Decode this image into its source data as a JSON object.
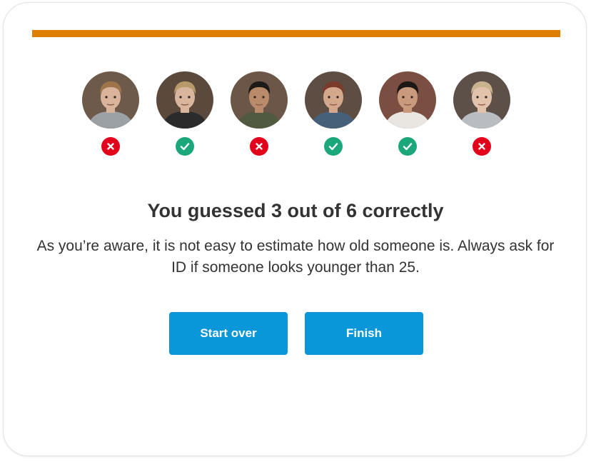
{
  "progress": {
    "fraction": 1.0,
    "color": "#e07e00"
  },
  "faces": [
    {
      "result": "incorrect",
      "icon": "cross-icon",
      "skin": "#d9b49a",
      "hair": "#a0744a",
      "shirt": "#9aa0a4",
      "bg": "#6e5a4b"
    },
    {
      "result": "correct",
      "icon": "check-icon",
      "skin": "#d8b59c",
      "hair": "#b89a6a",
      "shirt": "#2b2b2b",
      "bg": "#5b4a3c"
    },
    {
      "result": "incorrect",
      "icon": "cross-icon",
      "skin": "#b98b6b",
      "hair": "#1e1a18",
      "shirt": "#4f5a40",
      "bg": "#6b5648"
    },
    {
      "result": "correct",
      "icon": "check-icon",
      "skin": "#d4a88c",
      "hair": "#7a3b2c",
      "shirt": "#46607a",
      "bg": "#5d4d42"
    },
    {
      "result": "correct",
      "icon": "check-icon",
      "skin": "#c99a7c",
      "hair": "#1b1816",
      "shirt": "#e9e6e1",
      "bg": "#7a4e40"
    },
    {
      "result": "incorrect",
      "icon": "cross-icon",
      "skin": "#e2c2ab",
      "hair": "#c9b38e",
      "shirt": "#b9bcc0",
      "bg": "#5d5048"
    }
  ],
  "colors": {
    "correct": "#1ba77a",
    "incorrect": "#e2001a",
    "button": "#0a97d9"
  },
  "result": {
    "title": "You guessed 3 out of 6 correctly",
    "text": "As you’re aware, it is not easy to estimate how old someone is. Always ask for ID if someone looks younger than 25."
  },
  "buttons": {
    "start_over": "Start over",
    "finish": "Finish"
  }
}
